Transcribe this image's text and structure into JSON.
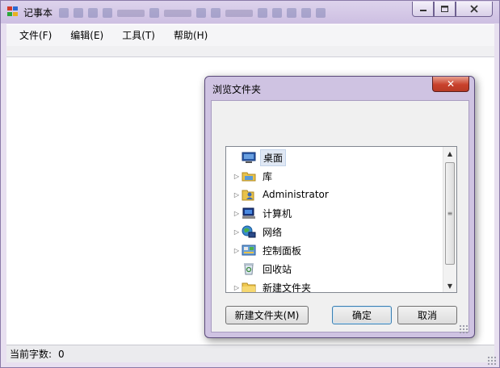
{
  "window": {
    "title": "记事本",
    "controls": {
      "minimize": "minimize-icon",
      "maximize": "maximize-icon",
      "close": "close-icon"
    }
  },
  "menu": {
    "items": [
      {
        "label": "文件(F)"
      },
      {
        "label": "编辑(E)"
      },
      {
        "label": "工具(T)"
      },
      {
        "label": "帮助(H)"
      }
    ]
  },
  "status": {
    "label": "当前字数:",
    "value": "0"
  },
  "dialog": {
    "title": "浏览文件夹",
    "close_glyph": "✕",
    "tree": [
      {
        "label": "桌面",
        "icon": "desktop-icon",
        "expandable": false,
        "selected": true
      },
      {
        "label": "库",
        "icon": "library-icon",
        "expandable": true
      },
      {
        "label": "Administrator",
        "icon": "user-folder-icon",
        "expandable": true
      },
      {
        "label": "计算机",
        "icon": "computer-icon",
        "expandable": true
      },
      {
        "label": "网络",
        "icon": "network-icon",
        "expandable": true
      },
      {
        "label": "控制面板",
        "icon": "control-panel-icon",
        "expandable": true
      },
      {
        "label": "回收站",
        "icon": "recycle-bin-icon",
        "expandable": false
      },
      {
        "label": "新建文件夹",
        "icon": "folder-icon",
        "expandable": true
      }
    ],
    "buttons": {
      "new_folder": "新建文件夹(M)",
      "ok": "确定",
      "cancel": "取消"
    }
  },
  "colors": {
    "titlebar": "#cdbfe2",
    "dialog_close": "#c8412c",
    "selection": "#e0e8f4"
  }
}
